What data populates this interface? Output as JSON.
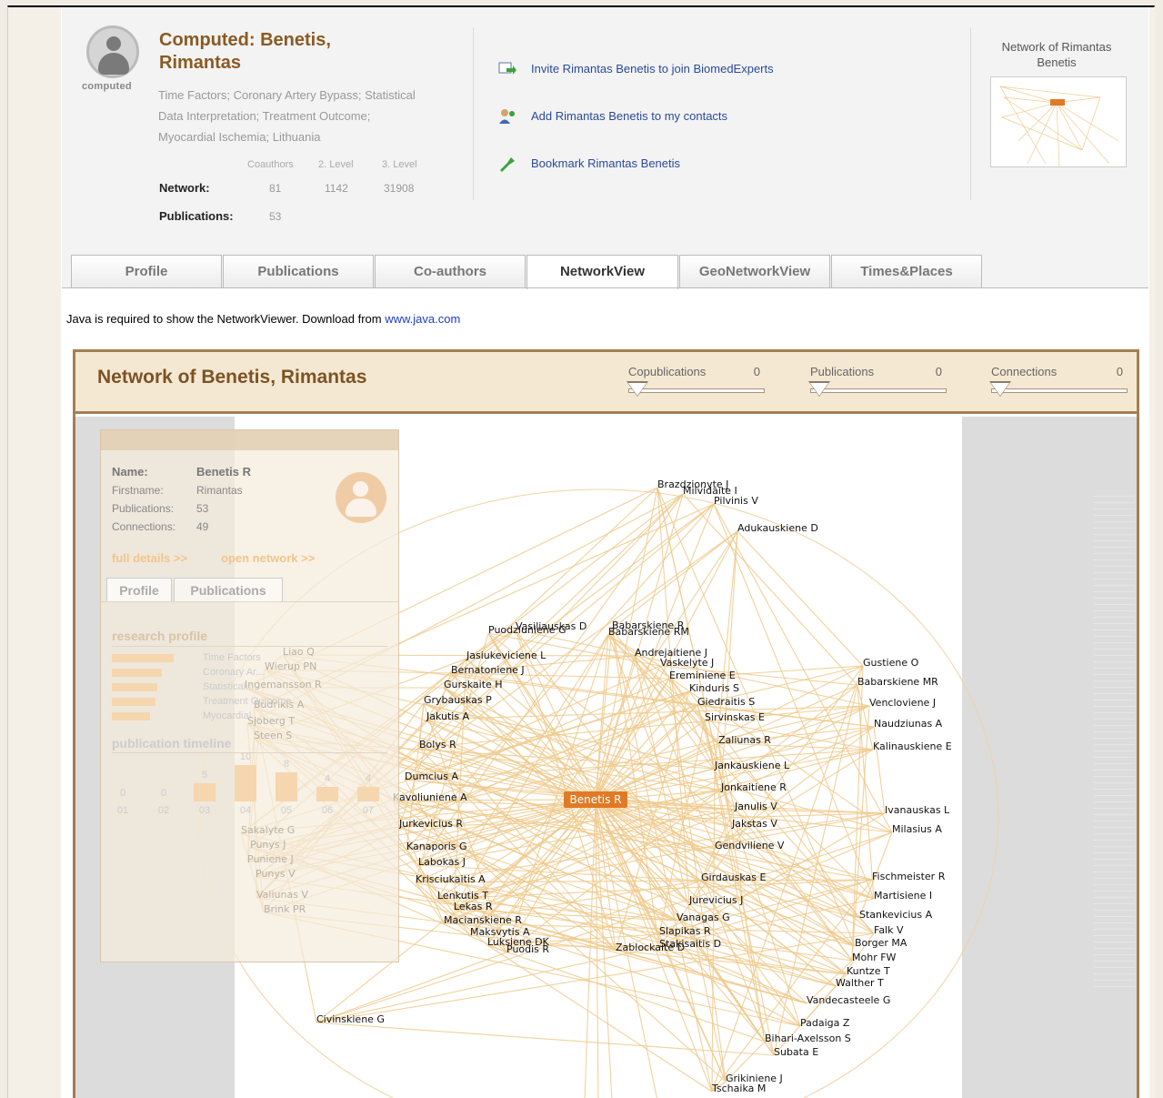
{
  "profile": {
    "avatar_label": "computed",
    "title_line1": "Computed: Benetis,",
    "title_line2": "Rimantas",
    "keywords_line1": "Time Factors;  Coronary Artery Bypass;  Statistical",
    "keywords_line2": "Data Interpretation;  Treatment Outcome;",
    "keywords_line3": "Myocardial Ischemia;  Lithuania",
    "col_coauthors": "Coauthors",
    "col_level2": "2. Level",
    "col_level3": "3. Level",
    "network_label": "Network:",
    "network_coauthors": "81",
    "network_level2": "1142",
    "network_level3": "31908",
    "publications_label": "Publications:",
    "publications_count": "53"
  },
  "actions": {
    "invite": "Invite Rimantas Benetis to join BiomedExperts",
    "add_contact": "Add Rimantas Benetis to my contacts",
    "bookmark": "Bookmark Rimantas Benetis"
  },
  "thumbnail": {
    "title": "Network of Rimantas Benetis"
  },
  "tabs": [
    "Profile",
    "Publications",
    "Co-authors",
    "NetworkView",
    "GeoNetworkView",
    "Times&Places"
  ],
  "active_tab": "NetworkView",
  "java_note": {
    "text": "Java is required to show the NetworkViewer. Download from ",
    "link": "www.java.com"
  },
  "viewer": {
    "title": "Network of Benetis, Rimantas",
    "sliders": [
      {
        "label": "Copublications",
        "value": "0"
      },
      {
        "label": "Publications",
        "value": "0"
      },
      {
        "label": "Connections",
        "value": "0"
      }
    ]
  },
  "panel": {
    "name_label": "Name:",
    "name_value": "Benetis R",
    "firstname_label": "Firstname:",
    "firstname_value": "Rimantas",
    "publications_label": "Publications:",
    "publications_value": "53",
    "connections_label": "Connections:",
    "connections_value": "49",
    "full_details": "full details >>",
    "open_network": "open network >>",
    "tab_profile": "Profile",
    "tab_publications": "Publications",
    "research_profile": "research profile",
    "research_items": [
      "Time Factors",
      "Coronary Ar...",
      "Statistical...",
      "Treatment Outcome",
      "Myocardial..."
    ],
    "publication_timeline": "publication timeline",
    "timeline": [
      {
        "year": "01",
        "count": "0"
      },
      {
        "year": "02",
        "count": "0"
      },
      {
        "year": "03",
        "count": "5"
      },
      {
        "year": "04",
        "count": "10"
      },
      {
        "year": "05",
        "count": "8"
      },
      {
        "year": "06",
        "count": "4"
      },
      {
        "year": "07",
        "count": "4"
      }
    ]
  },
  "network": {
    "center": "Benetis R",
    "nodes": [
      "Brazdzionyte J",
      "Milvidaite I",
      "Pilvinis V",
      "Adukauskiene D",
      "Vasiliauskas D",
      "Puodziuniene G",
      "Babarskiene R",
      "Babarskiene RM",
      "Jasiukeviciene L",
      "Andrejaitiene J",
      "Vaskelyte J",
      "Bernatoniene J",
      "Ereminiene E",
      "Gurskaite H",
      "Kinduris S",
      "Grybauskas P",
      "Giedraitis S",
      "Jakutis A",
      "Sirvinskas E",
      "Gustiene O",
      "Babarskiene MR",
      "Vencloviene J",
      "Naudziunas A",
      "Kalinauskiene E",
      "Liao Q",
      "Wierup PN",
      "Ingemansson R",
      "Budrikis A",
      "Sjoberg T",
      "Steen S",
      "Bolys R",
      "Zaliunas R",
      "Jankauskiene L",
      "Dumcius A",
      "Jonkaitiene R",
      "Kavoliuniene A",
      "Janulis V",
      "Ivanauskas L",
      "Jurkevicius R",
      "Jakstas V",
      "Milasius A",
      "Sakalyte G",
      "Punys J",
      "Kanaporis G",
      "Gendviliene V",
      "Puniene J",
      "Labokas J",
      "Punys V",
      "Krisciukaitis A",
      "Girdauskas E",
      "Fischmeister R",
      "Lenkutis T",
      "Jurevicius J",
      "Martisiene I",
      "Valiunas V",
      "Lekas R",
      "Brink PR",
      "Macianskiene R",
      "Vanagas G",
      "Stankevicius A",
      "Maksvytis A",
      "Slapikas R",
      "Falk V",
      "Luksiene DK",
      "Stakisaitis D",
      "Borger MA",
      "Puodis R",
      "Zablockaite D",
      "Mohr FW",
      "Kuntze T",
      "Walther T",
      "Vandecasteele G",
      "Civinskiene G",
      "Padaiga Z",
      "Bihari-Axelsson S",
      "Subata E",
      "Grikiniene J",
      "Tschaika M"
    ]
  }
}
